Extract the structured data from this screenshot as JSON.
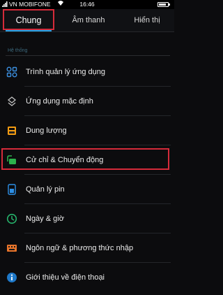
{
  "status": {
    "carrier": "VN MOBIFONE",
    "time": "16:46",
    "battery_level": 0.8
  },
  "tabs": [
    {
      "label": "Chung",
      "active": true
    },
    {
      "label": "Âm thanh",
      "active": false
    },
    {
      "label": "Hiển thị",
      "active": false
    }
  ],
  "section": {
    "header": "Hệ thống"
  },
  "items": [
    {
      "label": "Trình quản lý ứng dụng",
      "icon": "apps-grid-icon"
    },
    {
      "label": "Ứng dụng mặc định",
      "icon": "default-apps-icon"
    },
    {
      "label": "Dung lượng",
      "icon": "storage-icon"
    },
    {
      "label": "Cử chỉ & Chuyển động",
      "icon": "gesture-motion-icon"
    },
    {
      "label": "Quản lý pin",
      "icon": "battery-manager-icon"
    },
    {
      "label": "Ngày & giờ",
      "icon": "clock-icon"
    },
    {
      "label": "Ngôn ngữ & phương thức nhập",
      "icon": "language-input-icon"
    },
    {
      "label": "Giới thiệu về điện thoại",
      "icon": "info-icon"
    }
  ],
  "colors": {
    "accent": "#23a3e8",
    "highlight": "#d52b3a",
    "storage_orange": "#f39c12",
    "gesture_green": "#2bb24c",
    "date_green": "#26b36b",
    "language_orange": "#e8742a",
    "info_blue": "#1e78c8"
  }
}
